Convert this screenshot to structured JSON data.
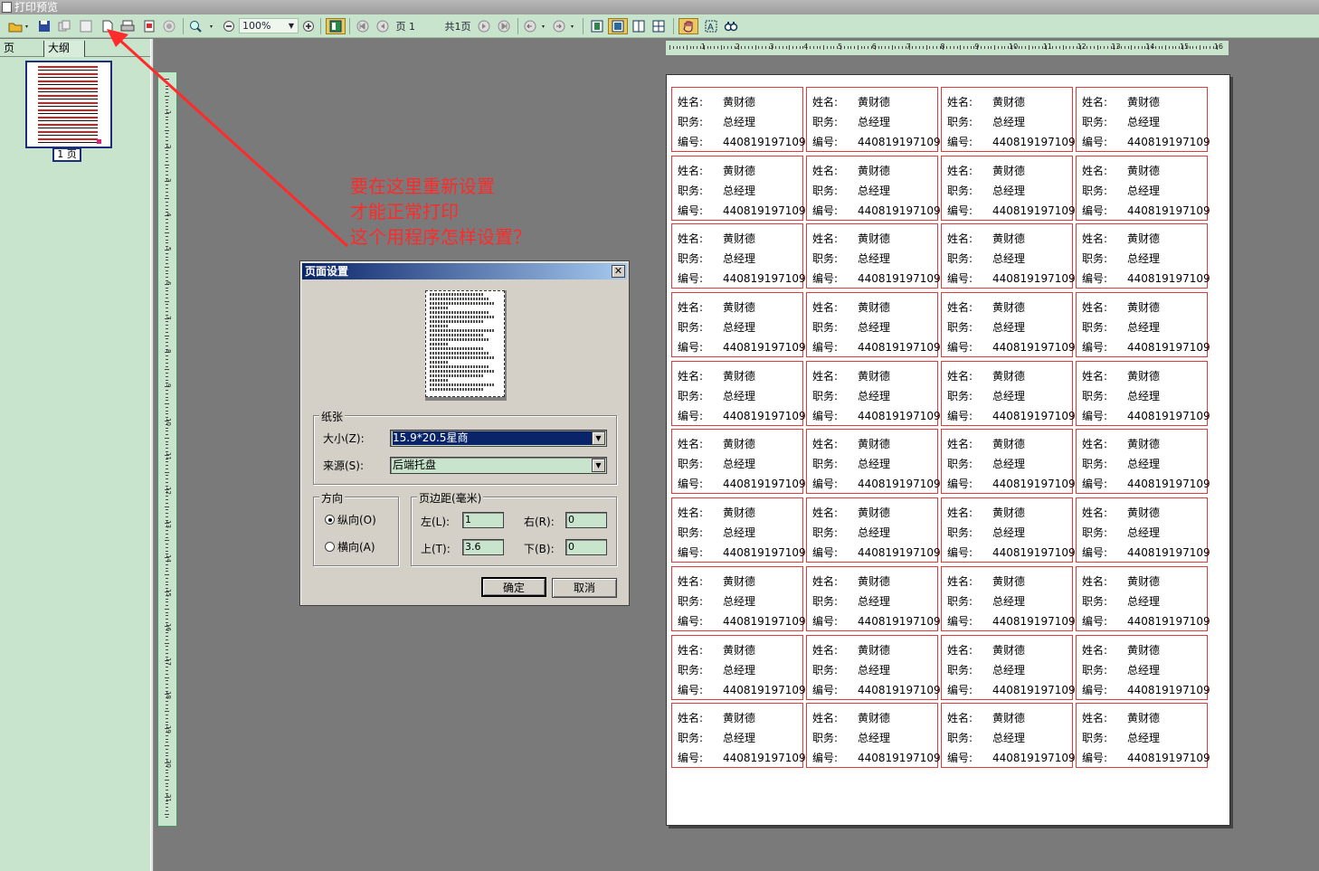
{
  "window": {
    "title": "打印预览"
  },
  "toolbar": {
    "zoom": "100%",
    "page_label": "页",
    "page_number": "1",
    "total_pages": "共1页"
  },
  "left_panel": {
    "tabs": [
      "页",
      "大纲"
    ],
    "thumbnail_label": "1 页"
  },
  "annotation": {
    "lines": [
      "要在这里重新设置",
      "才能正常打印",
      "这个用程序怎样设置？"
    ],
    "color": "#ff2a2a"
  },
  "dialog": {
    "title": "页面设置",
    "close": "✕",
    "paper_group": "纸张",
    "size_label": "大小(Z):",
    "size_value": "15.9*20.5星商",
    "source_label": "来源(S):",
    "source_value": "后端托盘",
    "orientation_group": "方向",
    "portrait": "纵向(O)",
    "landscape": "横向(A)",
    "margins_group": "页边距(毫米)",
    "left_label": "左(L):",
    "left_value": "1",
    "right_label": "右(R):",
    "right_value": "0",
    "top_label": "上(T):",
    "top_value": "3.6",
    "bottom_label": "下(B):",
    "bottom_value": "0",
    "ok": "确定",
    "cancel": "取消"
  },
  "card": {
    "name_label": "姓名:",
    "name_value": "黄财德",
    "title_label": "职务:",
    "title_value": "总经理",
    "id_label": "编号:",
    "id_value": "440819197109",
    "border_color": "#e03a3a"
  },
  "layout": {
    "columns": 4,
    "rows": 10
  },
  "ruler": {
    "h_numbers": [
      "1",
      "2",
      "3",
      "4",
      "5",
      "6",
      "7",
      "8",
      "9",
      "10",
      "11",
      "12",
      "13",
      "14",
      "15",
      "16"
    ],
    "v_numbers": [
      "1",
      "2",
      "3",
      "4",
      "5",
      "6",
      "7",
      "8",
      "9",
      "10",
      "11",
      "12",
      "13",
      "14",
      "15",
      "16",
      "17",
      "18",
      "19",
      "20",
      "21"
    ]
  }
}
